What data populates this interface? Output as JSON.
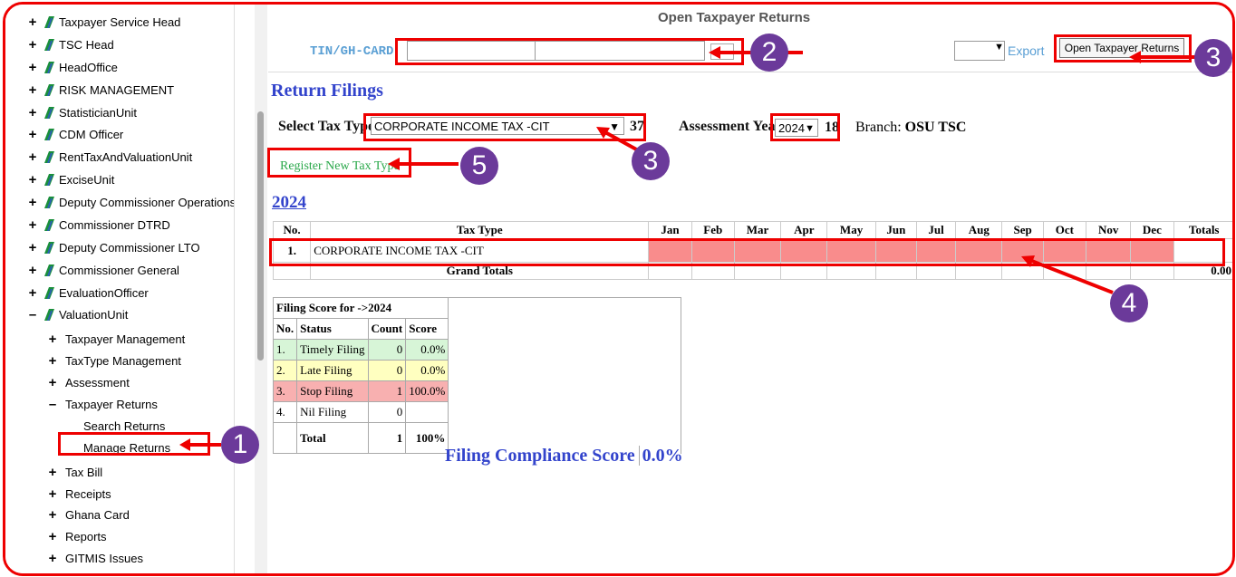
{
  "sidebar": {
    "top_items": [
      {
        "label": "Taxpayer Service Head",
        "toggle": "+"
      },
      {
        "label": "TSC Head",
        "toggle": "+"
      },
      {
        "label": "HeadOffice",
        "toggle": "+"
      },
      {
        "label": "RISK MANAGEMENT",
        "toggle": "+"
      },
      {
        "label": "StatisticianUnit",
        "toggle": "+"
      },
      {
        "label": "CDM Officer",
        "toggle": "+"
      },
      {
        "label": "RentTaxAndValuationUnit",
        "toggle": "+"
      },
      {
        "label": "ExciseUnit",
        "toggle": "+"
      },
      {
        "label": "Deputy Commissioner Operations",
        "toggle": "+"
      },
      {
        "label": "Commissioner DTRD",
        "toggle": "+"
      },
      {
        "label": "Deputy Commissioner LTO",
        "toggle": "+"
      },
      {
        "label": "Commissioner General",
        "toggle": "+"
      },
      {
        "label": "EvaluationOfficer",
        "toggle": "+"
      },
      {
        "label": "ValuationUnit",
        "toggle": "–"
      }
    ],
    "sub_items": [
      {
        "label": "Taxpayer Management",
        "toggle": "+"
      },
      {
        "label": "TaxType Management",
        "toggle": "+"
      },
      {
        "label": "Assessment",
        "toggle": "+"
      },
      {
        "label": "Taxpayer Returns",
        "toggle": "–"
      }
    ],
    "leaf_items": [
      {
        "label": "Search Returns"
      },
      {
        "label": "Manage Returns"
      }
    ],
    "bottom_items": [
      {
        "label": "Tax Bill",
        "toggle": "+"
      },
      {
        "label": "Receipts",
        "toggle": "+"
      },
      {
        "label": "Ghana Card",
        "toggle": "+"
      },
      {
        "label": "Reports",
        "toggle": "+"
      },
      {
        "label": "GITMIS Issues",
        "toggle": "+"
      }
    ]
  },
  "header": {
    "title": "Open Taxpayer Returns",
    "tin_label": "TIN/GH-CARD",
    "export_label": "Export",
    "open_button": "Open Taxpayer Returns"
  },
  "filters": {
    "section_title": "Return Filings",
    "tax_type_label": "Select Tax Type",
    "tax_type_value": "CORPORATE INCOME TAX -CIT",
    "tax_type_count": "37",
    "year_label": "Assessment Year",
    "year_value": "2024",
    "year_count": "18",
    "branch_label": "Branch:",
    "branch_value": "OSU TSC",
    "register_link": "Register New Tax Type",
    "year_heading": "2024"
  },
  "filings_table": {
    "headers": [
      "No.",
      "Tax Type",
      "Jan",
      "Feb",
      "Mar",
      "Apr",
      "May",
      "Jun",
      "Jul",
      "Aug",
      "Sep",
      "Oct",
      "Nov",
      "Dec",
      "Totals"
    ],
    "row": {
      "no": "1.",
      "tax_type": "CORPORATE INCOME TAX -CIT"
    },
    "grand_totals_label": "Grand Totals",
    "grand_totals_value": "0.00"
  },
  "score_table": {
    "title": "Filing Score for ->2024",
    "headers": [
      "No.",
      "Status",
      "Count",
      "Score"
    ],
    "rows": [
      {
        "no": "1.",
        "status": "Timely Filing",
        "count": "0",
        "score": "0.0%"
      },
      {
        "no": "2.",
        "status": "Late Filing",
        "count": "0",
        "score": "0.0%"
      },
      {
        "no": "3.",
        "status": "Stop Filing",
        "count": "1",
        "score": "100.0%"
      },
      {
        "no": "4.",
        "status": "Nil Filing",
        "count": "0",
        "score": ""
      }
    ],
    "total_label": "Total",
    "total_count": "1",
    "total_score": "100%",
    "compliance_label": "Filing Compliance Score",
    "compliance_value": "0.0%"
  },
  "annotations": {
    "badge1": "1",
    "badge2": "2",
    "badge3a": "3",
    "badge3b": "3",
    "badge4": "4",
    "badge5": "5",
    "annotation_color": "#e00000",
    "badge_color": "#6b3a9a"
  },
  "colors": {
    "stop_filing_fill": "#f98c8c",
    "heading_blue": "#3344cc",
    "link_green": "#2aa84a"
  }
}
